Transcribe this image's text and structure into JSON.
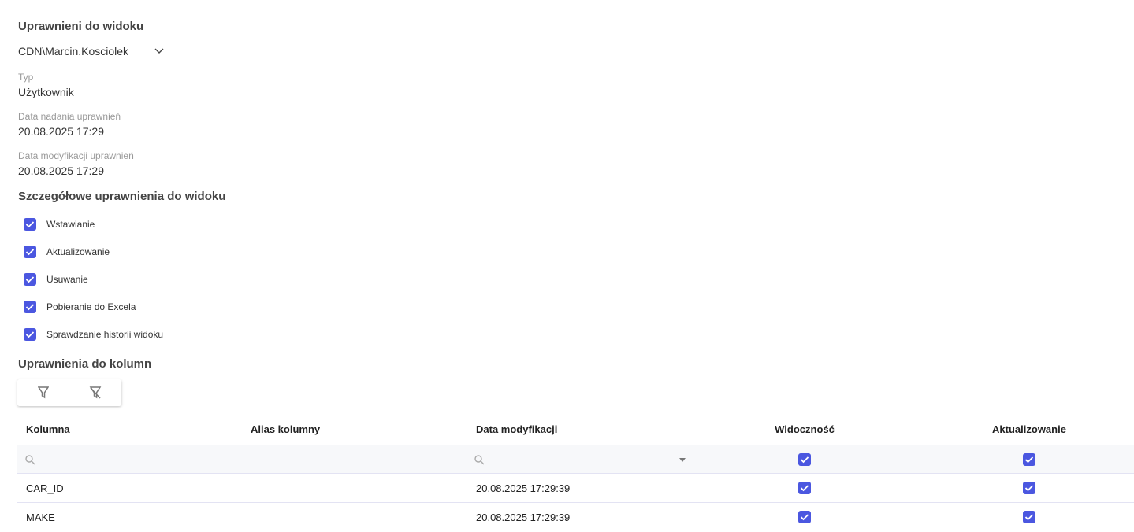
{
  "section_title": "Uprawnieni do widoku",
  "user_select": {
    "value": "CDN\\Marcin.Kosciolek"
  },
  "type": {
    "label": "Typ",
    "value": "Użytkownik"
  },
  "granted": {
    "label": "Data nadania uprawnień",
    "value": "20.08.2025 17:29"
  },
  "modified": {
    "label": "Data modyfikacji uprawnień",
    "value": "20.08.2025 17:29"
  },
  "details_title": "Szczegółowe uprawnienia do widoku",
  "permissions": [
    {
      "label": "Wstawianie",
      "checked": true
    },
    {
      "label": "Aktualizowanie",
      "checked": true
    },
    {
      "label": "Usuwanie",
      "checked": true
    },
    {
      "label": "Pobieranie do Excela",
      "checked": true
    },
    {
      "label": "Sprawdzanie historii widoku",
      "checked": true
    }
  ],
  "columns_title": "Uprawnienia do kolumn",
  "accent": "#4b57e0",
  "table": {
    "headers": [
      "Kolumna",
      "Alias kolumny",
      "Data modyfikacji",
      "Widoczność",
      "Aktualizowanie"
    ],
    "rows": [
      {
        "column": "CAR_ID",
        "alias": "",
        "modified": "20.08.2025 17:29:39",
        "visible": true,
        "update": true
      },
      {
        "column": "MAKE",
        "alias": "",
        "modified": "20.08.2025 17:29:39",
        "visible": true,
        "update": true
      }
    ]
  }
}
